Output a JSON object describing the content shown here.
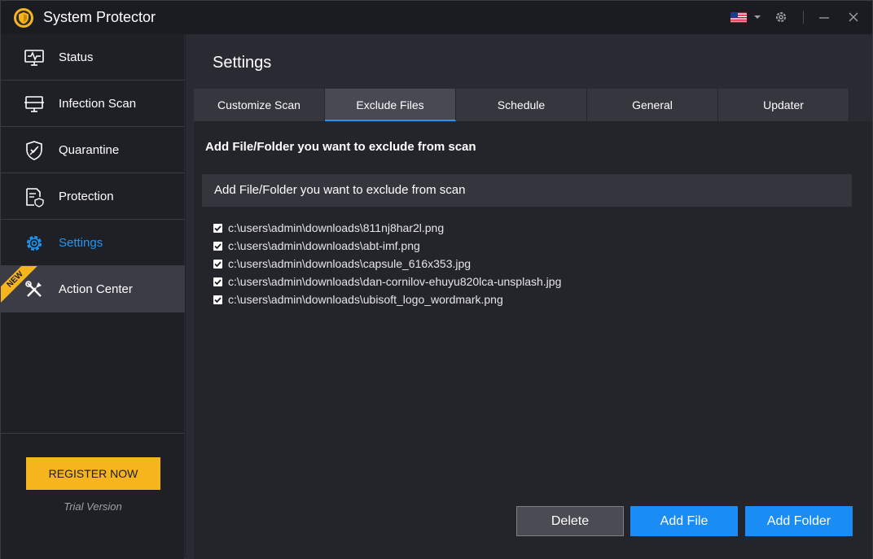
{
  "app": {
    "title": "System Protector"
  },
  "sidebar": {
    "items": [
      {
        "label": "Status",
        "icon": "monitor-pulse-icon"
      },
      {
        "label": "Infection Scan",
        "icon": "scan-monitor-icon"
      },
      {
        "label": "Quarantine",
        "icon": "shield-quarantine-icon"
      },
      {
        "label": "Protection",
        "icon": "document-shield-icon"
      },
      {
        "label": "Settings",
        "icon": "gear-icon"
      },
      {
        "label": "Action Center",
        "icon": "tools-icon"
      }
    ],
    "active_index": 4,
    "new_badge": "NEW",
    "register_label": "REGISTER NOW",
    "trial_label": "Trial Version"
  },
  "main": {
    "title": "Settings",
    "tabs": [
      {
        "label": "Customize Scan"
      },
      {
        "label": "Exclude Files"
      },
      {
        "label": "Schedule"
      },
      {
        "label": "General"
      },
      {
        "label": "Updater"
      }
    ],
    "active_tab": 1,
    "section_heading": "Add File/Folder you want to exclude from scan",
    "list_header": "Add File/Folder you want to exclude from scan",
    "excluded_items": [
      {
        "path": "c:\\users\\admin\\downloads\\811nj8har2l.png",
        "checked": true
      },
      {
        "path": "c:\\users\\admin\\downloads\\abt-imf.png",
        "checked": true
      },
      {
        "path": "c:\\users\\admin\\downloads\\capsule_616x353.jpg",
        "checked": true
      },
      {
        "path": "c:\\users\\admin\\downloads\\dan-cornilov-ehuyu820lca-unsplash.jpg",
        "checked": true
      },
      {
        "path": "c:\\users\\admin\\downloads\\ubisoft_logo_wordmark.png",
        "checked": true
      }
    ],
    "buttons": {
      "delete": "Delete",
      "add_file": "Add File",
      "add_folder": "Add Folder"
    }
  },
  "colors": {
    "accent": "#2196f3",
    "register": "#f6b51c",
    "primary_button": "#1a8cf5"
  }
}
